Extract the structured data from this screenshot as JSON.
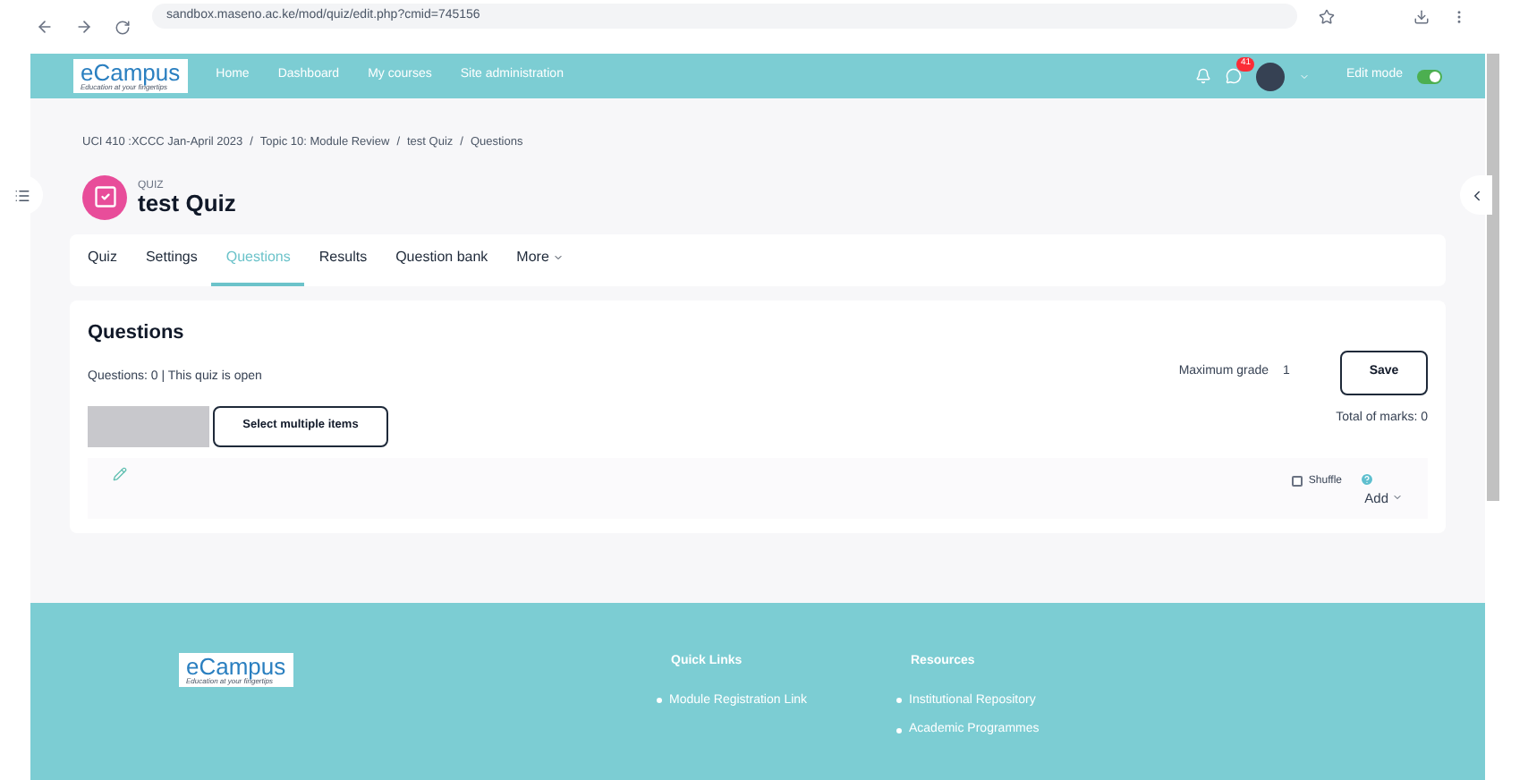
{
  "browser": {
    "url": "sandbox.maseno.ac.ke/mod/quiz/edit.php?cmid=745156"
  },
  "navbar": {
    "logo": "eCampus",
    "logo_tagline": "Education at your fingertips",
    "links": [
      {
        "label": "Home"
      },
      {
        "label": "Dashboard"
      },
      {
        "label": "My courses"
      },
      {
        "label": "Site administration"
      }
    ],
    "message_count": "41",
    "edit_mode": {
      "label": "Edit mode",
      "on": true
    }
  },
  "breadcrumb_separator": "/",
  "breadcrumb": [
    "UCI 410 :XCCC Jan-April 2023",
    "Topic 10: Module Review",
    "test Quiz",
    "Questions"
  ],
  "header": {
    "kind_label": "QUIZ",
    "title": "test Quiz"
  },
  "tabs": [
    {
      "label": "Quiz",
      "selected": false
    },
    {
      "label": "Settings",
      "selected": false
    },
    {
      "label": "Questions",
      "selected": true
    },
    {
      "label": "Results",
      "selected": false
    },
    {
      "label": "Question bank",
      "selected": false
    },
    {
      "label": "More",
      "selected": false
    }
  ],
  "questions": {
    "heading": "Questions",
    "status": "Questions: 0 | This quiz is open",
    "max_grade_label": "Maximum grade",
    "max_grade": "1",
    "save": "Save",
    "total": "Total of marks: 0",
    "repaginate_disabled": true,
    "select_multiple": "Select multiple items",
    "shuffle": {
      "label": "Shuffle",
      "checked": false
    },
    "add": "Add"
  },
  "footer": {
    "logo": "eCampus",
    "logo_tagline": "Education at your fingertips",
    "columns": [
      {
        "heading": "Quick Links",
        "items": [
          "Module Registration Link"
        ]
      },
      {
        "heading": "Resources",
        "items": [
          "Institutional Repository",
          "Academic Programmes"
        ]
      }
    ]
  }
}
